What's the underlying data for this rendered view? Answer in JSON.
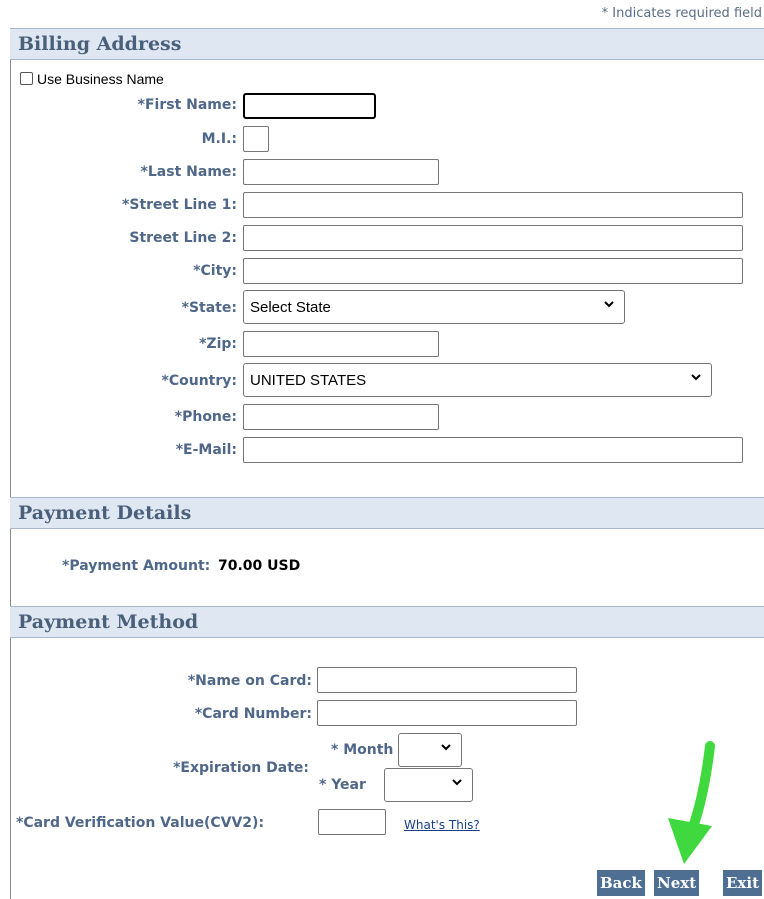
{
  "required_note": "* Indicates required field",
  "billing": {
    "title": "Billing Address",
    "use_business_name": "Use Business Name",
    "first_name_label": "*First Name:",
    "mi_label": "M.I.:",
    "last_name_label": "*Last Name:",
    "street1_label": "*Street Line 1:",
    "street2_label": "Street Line 2:",
    "city_label": "*City:",
    "state_label": "*State:",
    "state_value": "Select State",
    "zip_label": "*Zip:",
    "country_label": "*Country:",
    "country_value": "UNITED STATES",
    "phone_label": "*Phone:",
    "email_label": "*E-Mail:"
  },
  "payment_details": {
    "title": "Payment Details",
    "amount_label": "*Payment Amount:",
    "amount_value": "70.00 USD"
  },
  "payment_method": {
    "title": "Payment Method",
    "name_on_card_label": "*Name on Card:",
    "card_number_label": "*Card Number:",
    "expiration_label": "*Expiration Date:",
    "month_label": "* Month",
    "year_label": "* Year",
    "cvv_label": "*Card Verification Value(CVV2):",
    "whats_this": "What's This?"
  },
  "buttons": {
    "back": "Back",
    "next": "Next",
    "exit": "Exit"
  },
  "colors": {
    "section_bg": "#dfe7f2",
    "label_blue": "#4f6788",
    "button_bg": "#4e6e92",
    "arrow_green": "#3fd93f"
  }
}
